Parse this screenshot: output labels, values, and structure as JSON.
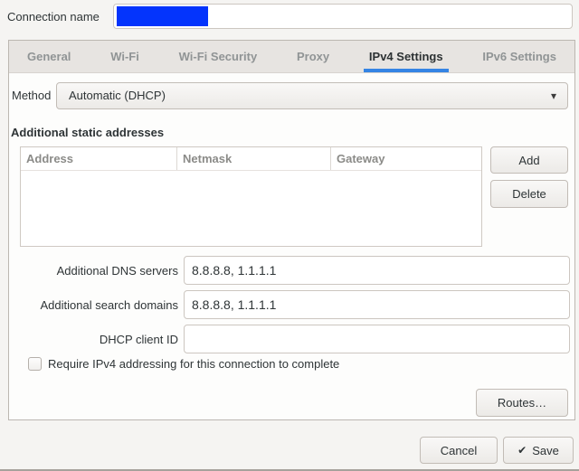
{
  "colors": {
    "accent_blue": "#3584e4",
    "redaction_blue": "#0434fc",
    "dialog_bg": "#f5f4f2",
    "tabbar_bg": "#e7e4e1",
    "panel_bg": "#fdfdfc"
  },
  "header": {
    "connection_name_label": "Connection name",
    "connection_name_value": ""
  },
  "tabs": [
    {
      "label": "General"
    },
    {
      "label": "Wi-Fi"
    },
    {
      "label": "Wi-Fi Security"
    },
    {
      "label": "Proxy"
    },
    {
      "label": "IPv4 Settings"
    },
    {
      "label": "IPv6 Settings"
    }
  ],
  "active_tab": "IPv4 Settings",
  "ipv4": {
    "method_label": "Method",
    "method_value": "Automatic (DHCP)",
    "section_title": "Additional static addresses",
    "table": {
      "columns": [
        "Address",
        "Netmask",
        "Gateway"
      ],
      "rows": []
    },
    "buttons": {
      "add": "Add",
      "delete": "Delete",
      "routes": "Routes…"
    },
    "fields": [
      {
        "label": "Additional DNS servers",
        "value": "8.8.8.8, 1.1.1.1"
      },
      {
        "label": "Additional search domains",
        "value": "8.8.8.8, 1.1.1.1"
      },
      {
        "label": "DHCP client ID",
        "value": ""
      }
    ],
    "require_checkbox": {
      "label": "Require IPv4 addressing for this connection to complete",
      "checked": false
    }
  },
  "footer": {
    "cancel": "Cancel",
    "save": "Save",
    "save_icon": "✔"
  },
  "dropdown_icon": "▾"
}
